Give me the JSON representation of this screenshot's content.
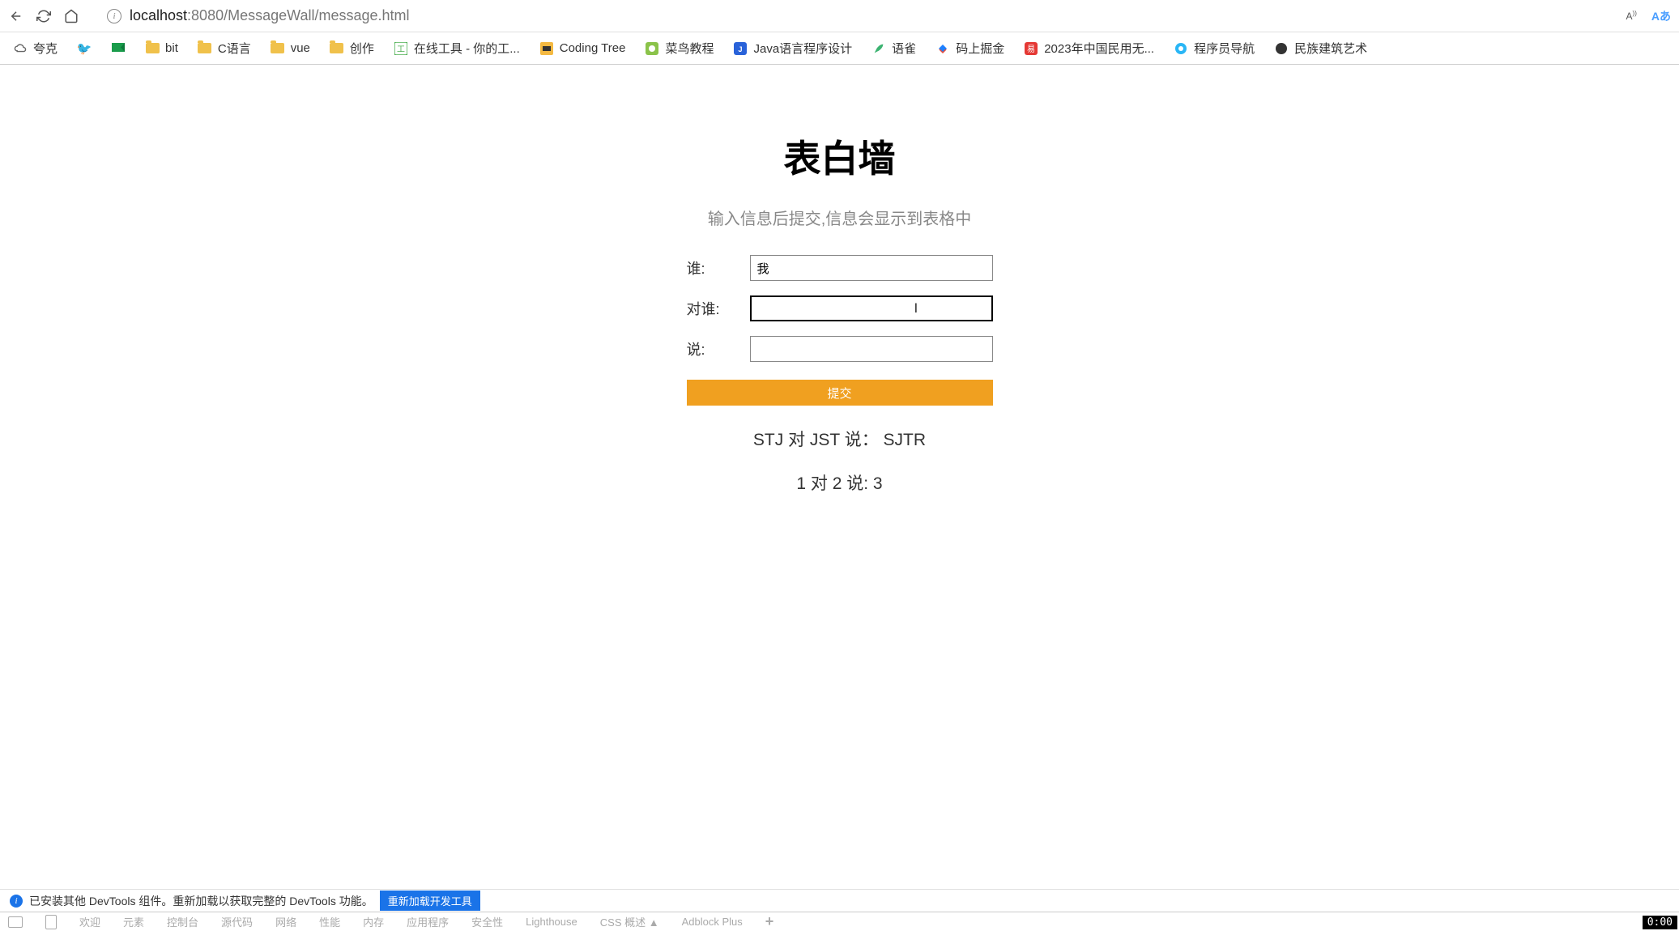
{
  "browser": {
    "url_host": "localhost",
    "url_port": ":8080",
    "url_path": "/MessageWall/message.html",
    "read_aloud": "Aあ",
    "font_indicator": "A"
  },
  "bookmarks": [
    {
      "label": "夸克",
      "icon": "cloud"
    },
    {
      "label": "",
      "icon": "bird"
    },
    {
      "label": "",
      "icon": "flag"
    },
    {
      "label": "bit",
      "icon": "folder"
    },
    {
      "label": "C语言",
      "icon": "folder"
    },
    {
      "label": "vue",
      "icon": "folder"
    },
    {
      "label": "创作",
      "icon": "folder"
    },
    {
      "label": "在线工具 - 你的工...",
      "icon": "tool"
    },
    {
      "label": "Coding Tree",
      "icon": "code"
    },
    {
      "label": "菜鸟教程",
      "icon": "runoob"
    },
    {
      "label": "Java语言程序设计",
      "icon": "java"
    },
    {
      "label": "语雀",
      "icon": "feather"
    },
    {
      "label": "码上掘金",
      "icon": "juejin"
    },
    {
      "label": "2023年中国民用无...",
      "icon": "red"
    },
    {
      "label": "程序员导航",
      "icon": "blue"
    },
    {
      "label": "民族建筑艺术",
      "icon": "dark"
    }
  ],
  "page": {
    "title": "表白墙",
    "subtitle": "输入信息后提交,信息会显示到表格中",
    "labels": {
      "who": "谁:",
      "to": "对谁:",
      "say": "说:"
    },
    "inputs": {
      "who": "我",
      "to": "",
      "say": ""
    },
    "submit": "提交",
    "messages": [
      "STJ 对 JST 说：  SJTR",
      "1 对 2 说: 3"
    ]
  },
  "devtools_notice": {
    "text": "已安装其他 DevTools 组件。重新加载以获取完整的 DevTools 功能。",
    "button": "重新加载开发工具"
  },
  "devtools_tabs": [
    "欢迎",
    "元素",
    "控制台",
    "源代码",
    "网络",
    "性能",
    "内存",
    "应用程序",
    "安全性",
    "Lighthouse",
    "CSS 概述 ▲",
    "Adblock Plus"
  ],
  "time": "0:00"
}
